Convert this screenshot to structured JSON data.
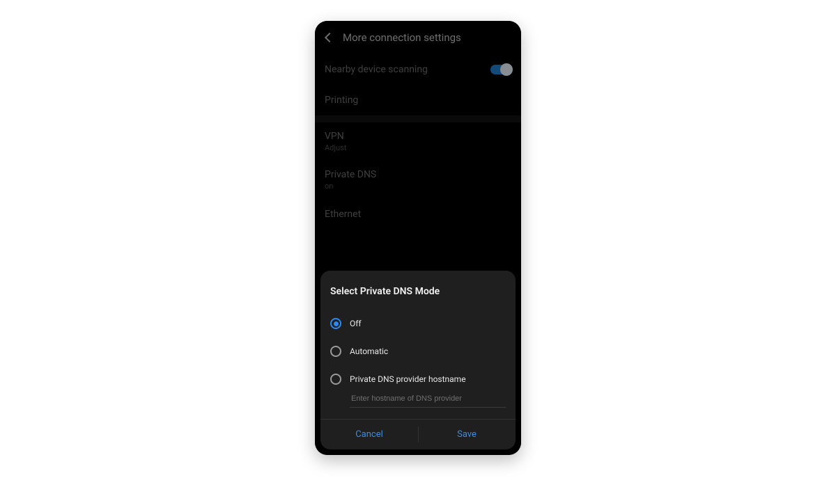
{
  "header": {
    "title": "More connection settings"
  },
  "settings": {
    "nearby_scanning": "Nearby device scanning",
    "printing": "Printing",
    "vpn_label": "VPN",
    "vpn_sub": "Adjust",
    "private_dns_label": "Private DNS",
    "private_dns_sub": "on",
    "ethernet": "Ethernet"
  },
  "dialog": {
    "title": "Select Private DNS Mode",
    "options": {
      "off": "Off",
      "automatic": "Automatic",
      "hostname": "Private DNS provider hostname"
    },
    "hostname_placeholder": "Enter hostname of DNS provider",
    "cancel": "Cancel",
    "save": "Save"
  }
}
